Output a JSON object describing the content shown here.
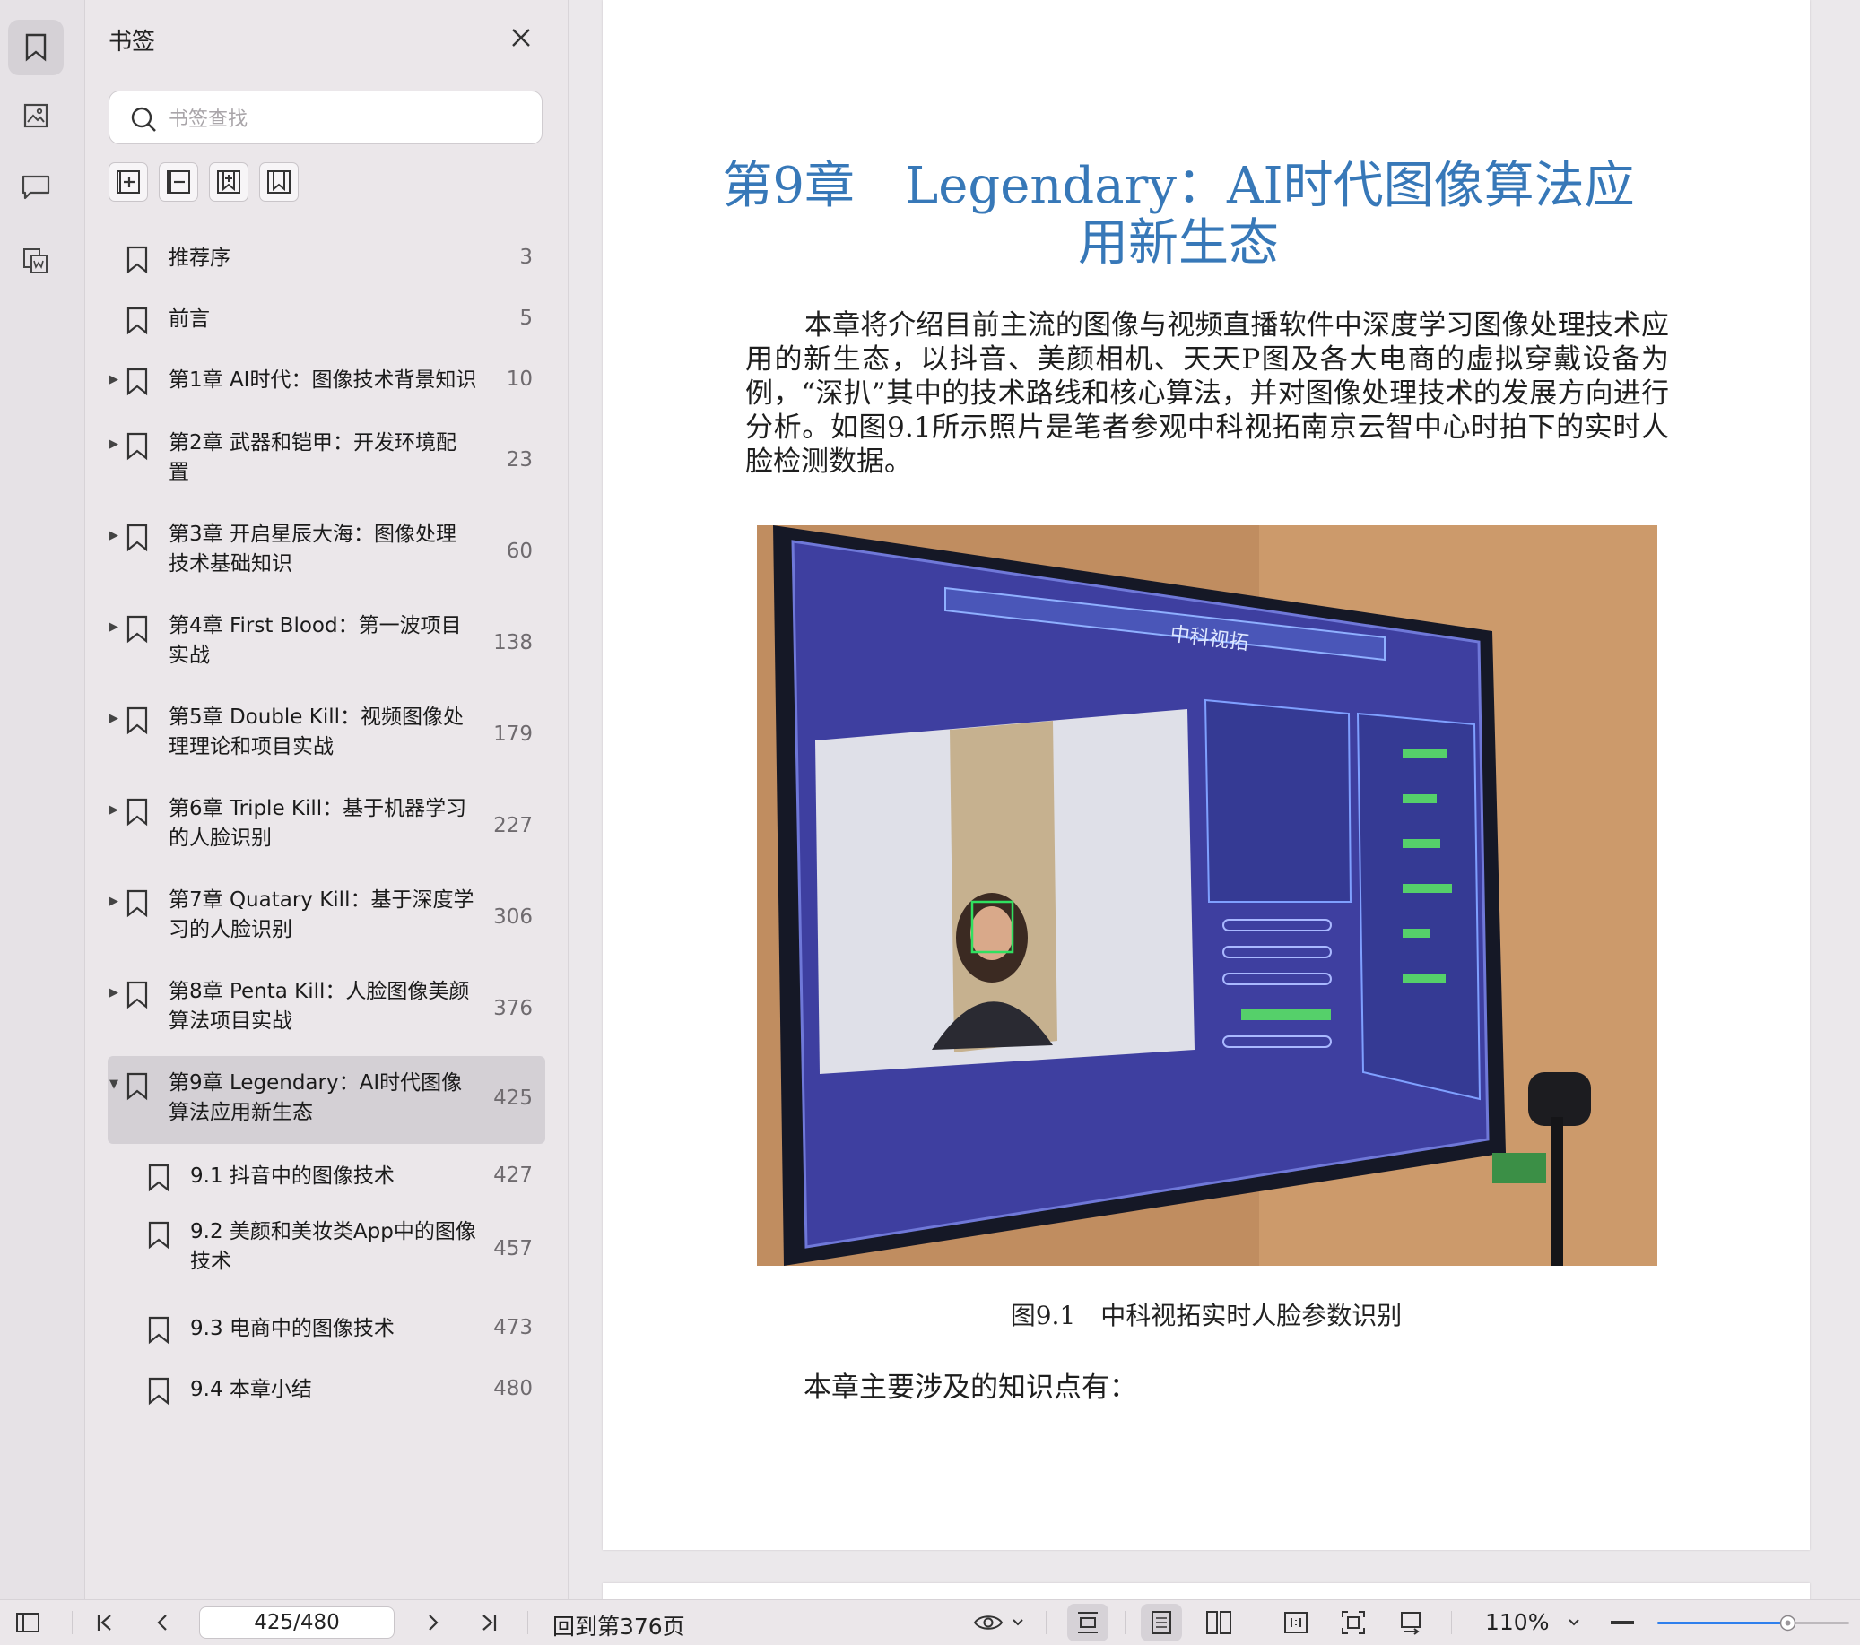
{
  "sidebar_panel": {
    "title": "书签",
    "search_placeholder": "书签查找",
    "bookmarks": [
      {
        "label": "推荐序",
        "page": "3"
      },
      {
        "label": "前言",
        "page": "5"
      },
      {
        "label": "第1章 AI时代：图像技术背景知识",
        "page": "10"
      },
      {
        "label": "第2章 武器和铠甲：开发环境配置",
        "page": "23"
      },
      {
        "label": "第3章 开启星辰大海：图像处理技术基础知识",
        "page": "60"
      },
      {
        "label": "第4章 First Blood：第一波项目实战",
        "page": "138"
      },
      {
        "label": "第5章 Double Kill：视频图像处理理论和项目实战",
        "page": "179"
      },
      {
        "label": "第6章 Triple Kill：基于机器学习的人脸识别",
        "page": "227"
      },
      {
        "label": "第7章 Quatary Kill：基于深度学习的人脸识别",
        "page": "306"
      },
      {
        "label": "第8章 Penta Kill：人脸图像美颜算法项目实战",
        "page": "376"
      },
      {
        "label": "第9章 Legendary：AI时代图像算法应用新生态",
        "page": "425"
      },
      {
        "label": "9.1 抖音中的图像技术",
        "page": "427"
      },
      {
        "label": "9.2 美颜和美妆类App中的图像技术",
        "page": "457"
      },
      {
        "label": "9.3 电商中的图像技术",
        "page": "473"
      },
      {
        "label": "9.4 本章小结",
        "page": "480"
      }
    ]
  },
  "document": {
    "chapter_title": "第9章　Legendary：AI时代图像算法应用新生态",
    "paragraph": "本章将介绍目前主流的图像与视频直播软件中深度学习图像处理技术应用的新生态，以抖音、美颜相机、天天P图及各大电商的虚拟穿戴设备为例，“深扒”其中的技术路线和核心算法，并对图像处理技术的发展方向进行分析。如图9.1所示照片是笔者参观中科视拓南京云智中心时拍下的实时人脸检测数据。",
    "figure_screen_label": "中科视拓",
    "figure_caption": "图9.1　中科视拓实时人脸参数识别",
    "knowledge_points": "本章主要涉及的知识点有："
  },
  "statusbar": {
    "page_indicator": "425/480",
    "back_to_page": "回到第376页",
    "zoom": "110%",
    "zoom_level_fraction": 0.68
  },
  "colors": {
    "accent_blue": "#3778b8",
    "slider_blue": "#2f80ed"
  }
}
